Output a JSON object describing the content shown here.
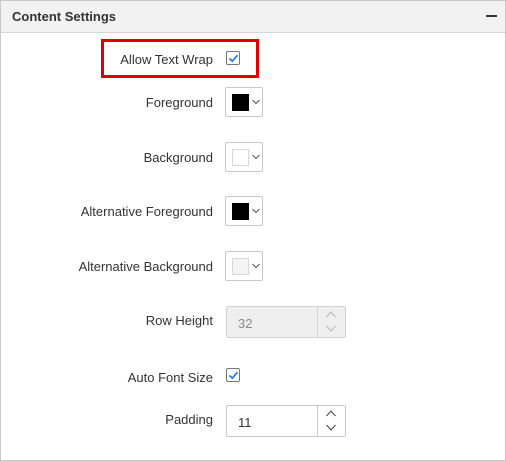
{
  "panel": {
    "title": "Content Settings",
    "collapse_icon": "minus-icon"
  },
  "fields": {
    "allow_text_wrap": {
      "label": "Allow Text Wrap",
      "checked": true
    },
    "foreground": {
      "label": "Foreground",
      "color": "#000000"
    },
    "background": {
      "label": "Background",
      "color": "#ffffff"
    },
    "alternative_foreground": {
      "label": "Alternative Foreground",
      "color": "#000000"
    },
    "alternative_background": {
      "label": "Alternative Background",
      "color": "#f4f4f4"
    },
    "row_height": {
      "label": "Row Height",
      "value": "32",
      "disabled": true
    },
    "auto_font_size": {
      "label": "Auto Font Size",
      "checked": true
    },
    "padding": {
      "label": "Padding",
      "value": "11",
      "disabled": false
    }
  },
  "colors": {
    "accent": "#1a73e8",
    "highlight": "#e00000"
  }
}
